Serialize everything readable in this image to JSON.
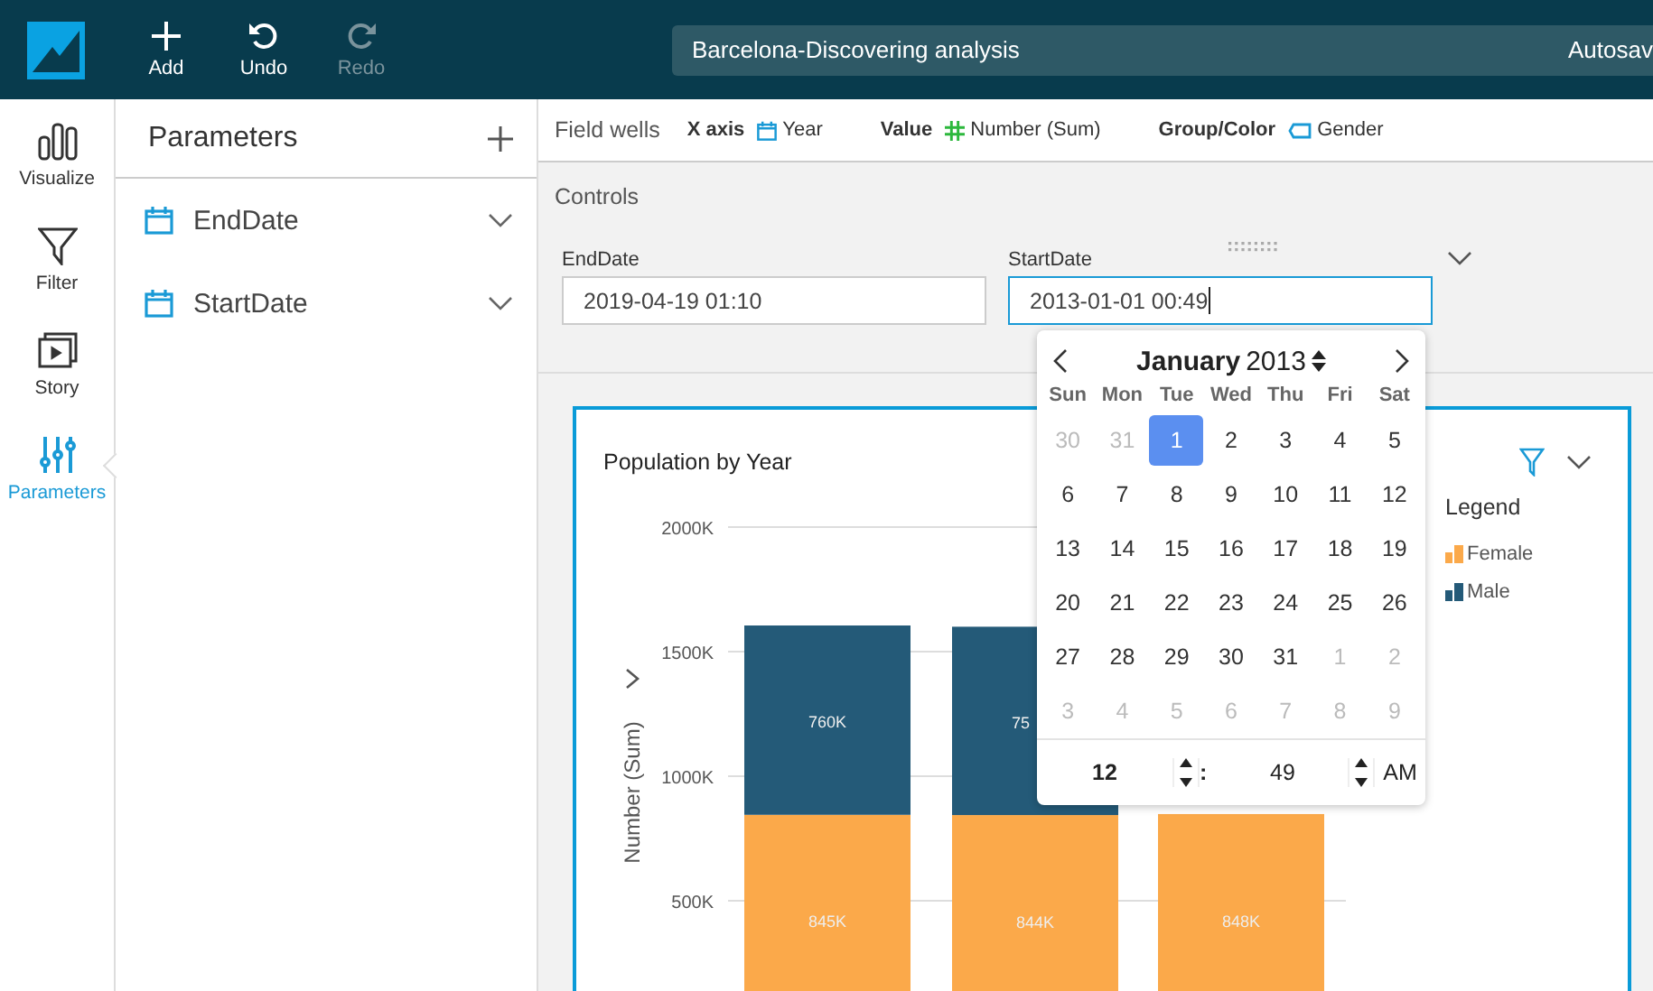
{
  "toolbar": {
    "buttons": [
      {
        "label": "Add",
        "disabled": false
      },
      {
        "label": "Undo",
        "disabled": false
      },
      {
        "label": "Redo",
        "disabled": true
      }
    ],
    "analysis_name": "Barcelona-Discovering analysis",
    "status": "Autosav"
  },
  "nav": [
    {
      "label": "Visualize",
      "selected": false
    },
    {
      "label": "Filter",
      "selected": false
    },
    {
      "label": "Story",
      "selected": false
    },
    {
      "label": "Parameters",
      "selected": true
    }
  ],
  "parameters_panel": {
    "title": "Parameters",
    "items": [
      {
        "name": "EndDate"
      },
      {
        "name": "StartDate"
      }
    ]
  },
  "field_wells": {
    "label": "Field wells",
    "wells": [
      {
        "label": "X axis",
        "field": "Year",
        "kind": "date"
      },
      {
        "label": "Value",
        "field": "Number (Sum)",
        "kind": "measure"
      },
      {
        "label": "Group/Color",
        "field": "Gender",
        "kind": "dimension"
      }
    ]
  },
  "controls": {
    "title": "Controls",
    "fields": [
      {
        "label": "EndDate",
        "value": "2019-04-19 01:10",
        "focused": false
      },
      {
        "label": "StartDate",
        "value": "2013-01-01 00:49",
        "focused": true
      }
    ]
  },
  "date_picker": {
    "month": "January",
    "year": "2013",
    "weekdays": [
      "Sun",
      "Mon",
      "Tue",
      "Wed",
      "Thu",
      "Fri",
      "Sat"
    ],
    "days": [
      {
        "day": "30",
        "outside": true,
        "selected": false
      },
      {
        "day": "31",
        "outside": true,
        "selected": false
      },
      {
        "day": "1",
        "outside": false,
        "selected": true
      },
      {
        "day": "2",
        "outside": false,
        "selected": false
      },
      {
        "day": "3",
        "outside": false,
        "selected": false
      },
      {
        "day": "4",
        "outside": false,
        "selected": false
      },
      {
        "day": "5",
        "outside": false,
        "selected": false
      },
      {
        "day": "6",
        "outside": false,
        "selected": false
      },
      {
        "day": "7",
        "outside": false,
        "selected": false
      },
      {
        "day": "8",
        "outside": false,
        "selected": false
      },
      {
        "day": "9",
        "outside": false,
        "selected": false
      },
      {
        "day": "10",
        "outside": false,
        "selected": false
      },
      {
        "day": "11",
        "outside": false,
        "selected": false
      },
      {
        "day": "12",
        "outside": false,
        "selected": false
      },
      {
        "day": "13",
        "outside": false,
        "selected": false
      },
      {
        "day": "14",
        "outside": false,
        "selected": false
      },
      {
        "day": "15",
        "outside": false,
        "selected": false
      },
      {
        "day": "16",
        "outside": false,
        "selected": false
      },
      {
        "day": "17",
        "outside": false,
        "selected": false
      },
      {
        "day": "18",
        "outside": false,
        "selected": false
      },
      {
        "day": "19",
        "outside": false,
        "selected": false
      },
      {
        "day": "20",
        "outside": false,
        "selected": false
      },
      {
        "day": "21",
        "outside": false,
        "selected": false
      },
      {
        "day": "22",
        "outside": false,
        "selected": false
      },
      {
        "day": "23",
        "outside": false,
        "selected": false
      },
      {
        "day": "24",
        "outside": false,
        "selected": false
      },
      {
        "day": "25",
        "outside": false,
        "selected": false
      },
      {
        "day": "26",
        "outside": false,
        "selected": false
      },
      {
        "day": "27",
        "outside": false,
        "selected": false
      },
      {
        "day": "28",
        "outside": false,
        "selected": false
      },
      {
        "day": "29",
        "outside": false,
        "selected": false
      },
      {
        "day": "30",
        "outside": false,
        "selected": false
      },
      {
        "day": "31",
        "outside": false,
        "selected": false
      },
      {
        "day": "1",
        "outside": true,
        "selected": false
      },
      {
        "day": "2",
        "outside": true,
        "selected": false
      },
      {
        "day": "3",
        "outside": true,
        "selected": false
      },
      {
        "day": "4",
        "outside": true,
        "selected": false
      },
      {
        "day": "5",
        "outside": true,
        "selected": false
      },
      {
        "day": "6",
        "outside": true,
        "selected": false
      },
      {
        "day": "7",
        "outside": true,
        "selected": false
      },
      {
        "day": "8",
        "outside": true,
        "selected": false
      },
      {
        "day": "9",
        "outside": true,
        "selected": false
      }
    ],
    "hour": "12",
    "separator": ":",
    "minute": "49",
    "period": "AM"
  },
  "visual": {
    "title": "Population by Year",
    "chart_data": {
      "type": "bar",
      "ylabel": "Number (Sum)",
      "stacked": true,
      "grid": true,
      "ylim": [
        0,
        2000000
      ],
      "yticks": [
        {
          "value": 500000,
          "label": "500K"
        },
        {
          "value": 1000000,
          "label": "1000K"
        },
        {
          "value": 1500000,
          "label": "1500K"
        },
        {
          "value": 2000000,
          "label": "2000K"
        }
      ],
      "series": [
        {
          "name": "Female",
          "color": "#fba94a",
          "values": [
            845000,
            844000,
            848000
          ]
        },
        {
          "name": "Male",
          "color": "#245a78",
          "values": [
            760000,
            756000,
            null
          ]
        }
      ],
      "value_labels": [
        [
          "845K",
          "844K",
          "848K"
        ],
        [
          "760K",
          "75",
          null
        ]
      ]
    },
    "legend": {
      "title": "Legend"
    }
  }
}
